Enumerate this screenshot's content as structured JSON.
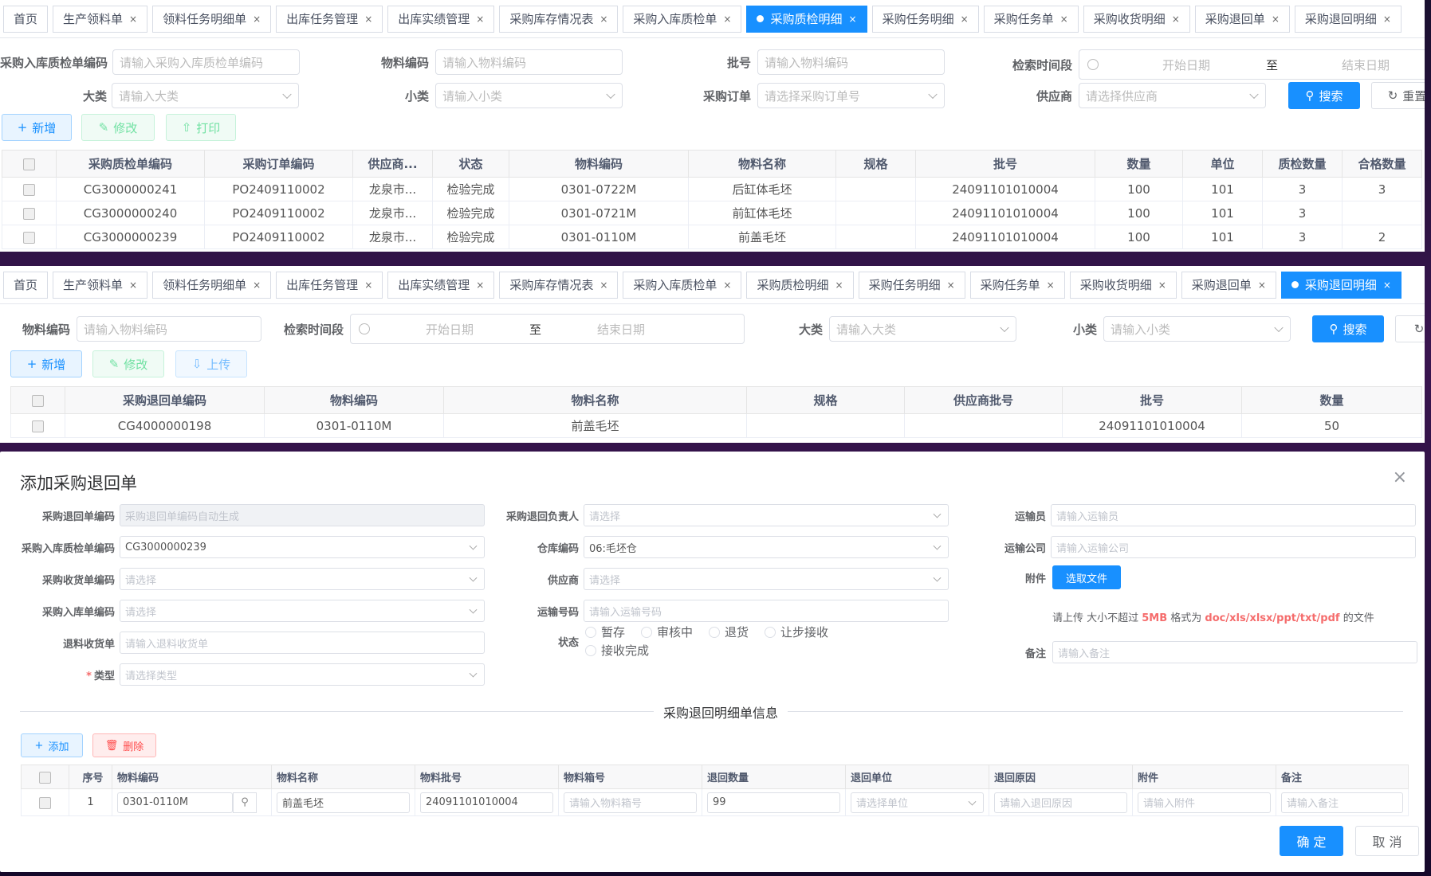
{
  "panel1": {
    "tabs": [
      {
        "label": "首页",
        "closable": false
      },
      {
        "label": "生产领料单",
        "closable": true
      },
      {
        "label": "领料任务明细单",
        "closable": true
      },
      {
        "label": "出库任务管理",
        "closable": true
      },
      {
        "label": "出库实绩管理",
        "closable": true
      },
      {
        "label": "采购库存情况表",
        "closable": true
      },
      {
        "label": "采购入库质检单",
        "closable": true
      },
      {
        "label": "采购质检明细",
        "closable": true,
        "active": true
      },
      {
        "label": "采购任务明细",
        "closable": true
      },
      {
        "label": "采购任务单",
        "closable": true
      },
      {
        "label": "采购收货明细",
        "closable": true
      },
      {
        "label": "采购退回单",
        "closable": true
      },
      {
        "label": "采购退回明细",
        "closable": true
      }
    ],
    "filters": {
      "qc_code_label": "采购入库质检单编码",
      "qc_code_ph": "请输入采购入库质检单编码",
      "mat_code_label": "物料编码",
      "mat_code_ph": "请输入物料编码",
      "batch_label": "批号",
      "batch_ph": "请输入物料编码",
      "time_label": "检索时间段",
      "start_ph": "开始日期",
      "to": "至",
      "end_ph": "结束日期",
      "big_label": "大类",
      "big_ph": "请输入大类",
      "small_label": "小类",
      "small_ph": "请输入小类",
      "po_label": "采购订单",
      "po_ph": "请选择采购订单号",
      "supplier_label": "供应商",
      "supplier_ph": "请选择供应商",
      "search": "搜索",
      "reset": "重置"
    },
    "actions": {
      "add": "新增",
      "edit": "修改",
      "print": "打印"
    },
    "table": {
      "headers": [
        "采购质检单编码",
        "采购订单编码",
        "供应商...",
        "状态",
        "物料编码",
        "物料名称",
        "规格",
        "批号",
        "数量",
        "单位",
        "质检数量",
        "合格数量"
      ],
      "rows": [
        [
          "CG3000000241",
          "PO2409110002",
          "龙泉市...",
          "检验完成",
          "0301-0722M",
          "后缸体毛坯",
          "",
          "24091101010004",
          "100",
          "101",
          "3",
          "3"
        ],
        [
          "CG3000000240",
          "PO2409110002",
          "龙泉市...",
          "检验完成",
          "0301-0721M",
          "前缸体毛坯",
          "",
          "24091101010004",
          "100",
          "101",
          "3",
          ""
        ],
        [
          "CG3000000239",
          "PO2409110002",
          "龙泉市...",
          "检验完成",
          "0301-0110M",
          "前盖毛坯",
          "",
          "24091101010004",
          "100",
          "101",
          "3",
          "2"
        ]
      ]
    }
  },
  "panel2": {
    "tabs": [
      {
        "label": "首页",
        "closable": false
      },
      {
        "label": "生产领料单",
        "closable": true
      },
      {
        "label": "领料任务明细单",
        "closable": true
      },
      {
        "label": "出库任务管理",
        "closable": true
      },
      {
        "label": "出库实绩管理",
        "closable": true
      },
      {
        "label": "采购库存情况表",
        "closable": true
      },
      {
        "label": "采购入库质检单",
        "closable": true
      },
      {
        "label": "采购质检明细",
        "closable": true
      },
      {
        "label": "采购任务明细",
        "closable": true
      },
      {
        "label": "采购任务单",
        "closable": true
      },
      {
        "label": "采购收货明细",
        "closable": true
      },
      {
        "label": "采购退回单",
        "closable": true
      },
      {
        "label": "采购退回明细",
        "closable": true,
        "active": true
      }
    ],
    "filters": {
      "mat_code_label": "物料编码",
      "mat_code_ph": "请输入物料编码",
      "time_label": "检索时间段",
      "start_ph": "开始日期",
      "to": "至",
      "end_ph": "结束日期",
      "big_label": "大类",
      "big_ph": "请输入大类",
      "small_label": "小类",
      "small_ph": "请输入小类",
      "search": "搜索"
    },
    "actions": {
      "add": "新增",
      "edit": "修改",
      "upload": "上传"
    },
    "table": {
      "headers": [
        "采购退回单编码",
        "物料编码",
        "物料名称",
        "规格",
        "供应商批号",
        "批号",
        "数量"
      ],
      "rows": [
        [
          "CG4000000198",
          "0301-0110M",
          "前盖毛坯",
          "",
          "",
          "24091101010004",
          "50"
        ]
      ]
    }
  },
  "modal": {
    "title": "添加采购退回单",
    "col1": [
      {
        "label": "采购退回单编码",
        "value": "采购退回单编码自动生成",
        "type": "disabled"
      },
      {
        "label": "采购入库质检单编码",
        "value": "CG3000000239",
        "type": "select-val"
      },
      {
        "label": "采购收货单编码",
        "value": "请选择",
        "type": "select"
      },
      {
        "label": "采购入库单编码",
        "value": "请选择",
        "type": "select"
      },
      {
        "label": "退料收货单",
        "value": "请输入退料收货单",
        "type": "input"
      },
      {
        "label": "类型",
        "value": "请选择类型",
        "type": "select",
        "required": true
      }
    ],
    "col2": [
      {
        "label": "采购退回负责人",
        "value": "请选择",
        "type": "select"
      },
      {
        "label": "仓库编码",
        "value": "06:毛坯仓",
        "type": "select-val"
      },
      {
        "label": "供应商",
        "value": "请选择",
        "type": "select"
      },
      {
        "label": "运输号码",
        "value": "请输入运输号码",
        "type": "input"
      }
    ],
    "status_label": "状态",
    "status_options": [
      "暂存",
      "审核中",
      "退货",
      "让步接收",
      "接收完成"
    ],
    "col3": [
      {
        "label": "运输员",
        "value": "请输入运输员"
      },
      {
        "label": "运输公司",
        "value": "请输入运输公司"
      }
    ],
    "attach_label": "附件",
    "attach_btn": "选取文件",
    "upload_hint_pre": "请上传 大小不超过 ",
    "upload_hint_size": "5MB",
    "upload_hint_mid": " 格式为 ",
    "upload_hint_fmt": "doc/xls/xlsx/ppt/txt/pdf",
    "upload_hint_post": " 的文件",
    "remark_label": "备注",
    "remark_ph": "请输入备注",
    "section_title": "采购退回明细单信息",
    "add_btn": "添加",
    "del_btn": "删除",
    "detail_headers": [
      "序号",
      "物料编码",
      "物料名称",
      "物料批号",
      "物料箱号",
      "退回数量",
      "退回单位",
      "退回原因",
      "附件",
      "备注"
    ],
    "detail_row": {
      "seq": "1",
      "code": "0301-0110M",
      "name": "前盖毛坯",
      "batch": "24091101010004",
      "box_ph": "请输入物料箱号",
      "qty": "99",
      "unit_ph": "请选择单位",
      "reason_ph": "请输入退回原因",
      "attach_ph": "请输入附件",
      "remark_ph": "请输入备注"
    },
    "ok": "确 定",
    "cancel": "取 消"
  }
}
